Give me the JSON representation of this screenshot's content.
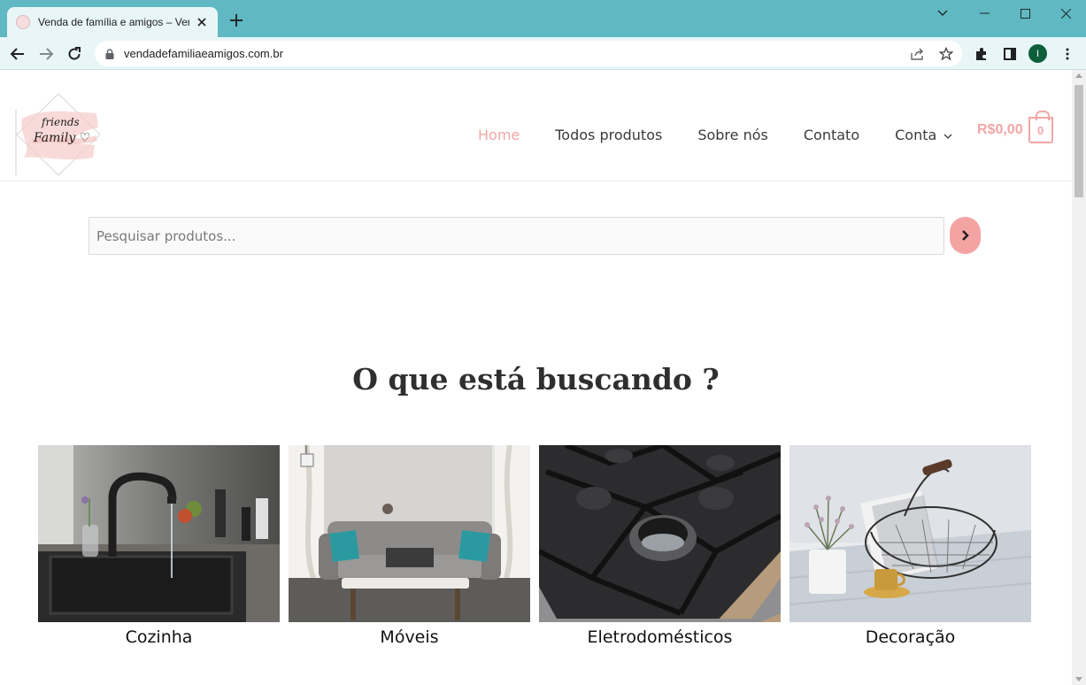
{
  "browser": {
    "tab_title": "Venda de família e amigos – Venda de família e amigos",
    "url": "vendadefamiliaeamigos.com.br",
    "profile_initial": "I"
  },
  "header": {
    "nav": [
      "Home",
      "Todos produtos",
      "Sobre nós",
      "Contato",
      "Conta"
    ],
    "cart_total": "R$0,00",
    "cart_count": "0"
  },
  "search": {
    "placeholder": "Pesquisar produtos..."
  },
  "main": {
    "section_title": "O que está buscando ?",
    "categories": [
      "Cozinha",
      "Móveis",
      "Eletrodomésticos",
      "Decoração"
    ]
  },
  "colors": {
    "accent": "#f2a6a6",
    "browser_frame": "#5fb8c2"
  }
}
